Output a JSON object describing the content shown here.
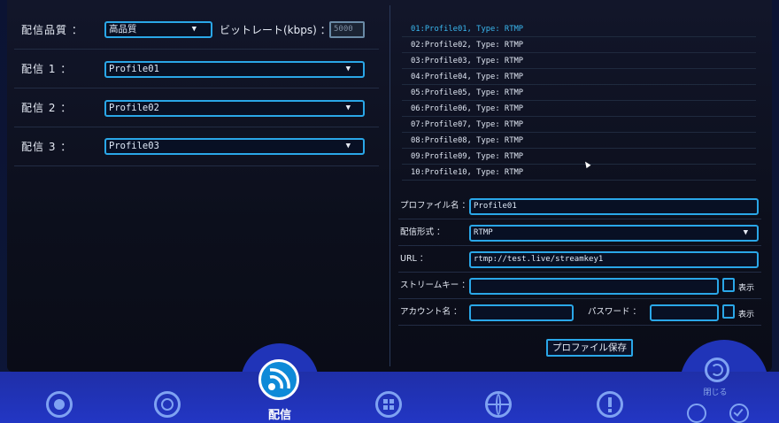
{
  "left": {
    "quality_label": "配信品質 ：",
    "quality_value": "高品質",
    "bitrate_label": "ビットレート(kbps) ：",
    "bitrate_value": "5000",
    "streams": [
      {
        "label": "配信 1 ：",
        "value": "Profile01"
      },
      {
        "label": "配信 2 ：",
        "value": "Profile02"
      },
      {
        "label": "配信 3 ：",
        "value": "Profile03"
      }
    ]
  },
  "profile_list": [
    "01:Profile01, Type: RTMP",
    "02:Profile02, Type: RTMP",
    "03:Profile03, Type: RTMP",
    "04:Profile04, Type: RTMP",
    "05:Profile05, Type: RTMP",
    "06:Profile06, Type: RTMP",
    "07:Profile07, Type: RTMP",
    "08:Profile08, Type: RTMP",
    "09:Profile09, Type: RTMP",
    "10:Profile10, Type: RTMP"
  ],
  "form": {
    "profile_name_label": "プロファイル名 ：",
    "profile_name_value": "Profile01",
    "format_label": "配信形式 ：",
    "format_value": "RTMP",
    "url_label": "URL ：",
    "url_value": "rtmp://test.live/streamkey1",
    "stream_key_label": "ストリームキー ：",
    "stream_key_value": "",
    "show_label": "表示",
    "account_label": "アカウント名 ：",
    "account_value": "",
    "password_label": "パスワード ：",
    "password_value": "",
    "save_label": "プロファイル保存"
  },
  "nav": {
    "active_label": "配信",
    "close_label": "閉じる"
  },
  "colors": {
    "accent": "#2aa7e8",
    "nav_bg": "#2236c4",
    "selected_text": "#3ab8f0"
  }
}
